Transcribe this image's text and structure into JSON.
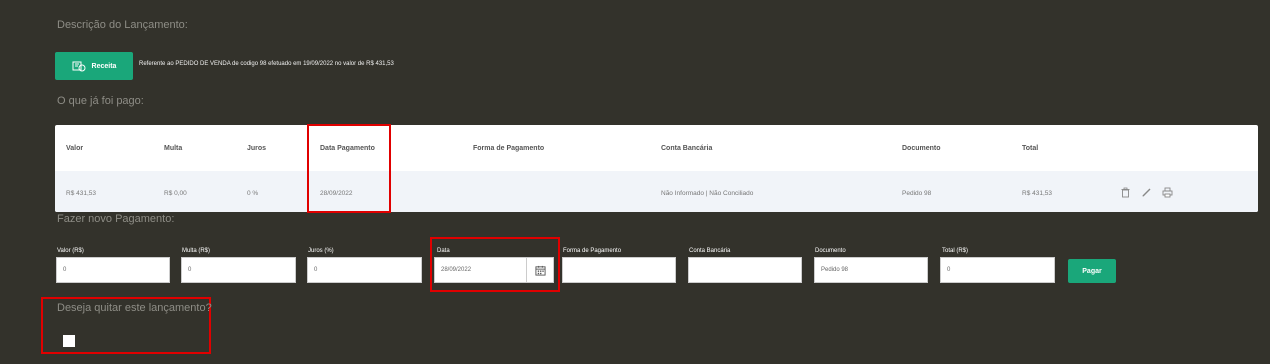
{
  "description_heading": "Descrição do Lançamento:",
  "receita_button": "Receita",
  "reference_text": "Referente ao PEDIDO DE VENDA de codigo 98 efetuado em 19/09/2022 no valor de R$ 431,53",
  "paid_heading": "O que já foi pago:",
  "table": {
    "headers": [
      "Valor",
      "Multa",
      "Juros",
      "Data Pagamento",
      "Forma de Pagamento",
      "Conta Bancária",
      "Documento",
      "Total"
    ],
    "row": {
      "valor": "R$ 431,53",
      "multa": "R$ 0,00",
      "juros": "0 %",
      "data": "28/09/2022",
      "forma": "",
      "conta": "Não Informado | Não Conciliado",
      "documento": "Pedido 98",
      "total": "R$ 431,53"
    },
    "row_action_icons": [
      "trash-icon",
      "pencil-icon",
      "print-icon"
    ]
  },
  "new_payment_heading": "Fazer novo Pagamento:",
  "form": {
    "valor": {
      "label": "Valor (R$)",
      "value": "0"
    },
    "multa": {
      "label": "Multa (R$)",
      "value": "0"
    },
    "juros": {
      "label": "Juros (%)",
      "value": "0"
    },
    "data": {
      "label": "Data",
      "value": "28/09/2022"
    },
    "forma": {
      "label": "Forma de Pagamento",
      "value": ""
    },
    "conta": {
      "label": "Conta Bancária",
      "value": ""
    },
    "documento": {
      "label": "Documento",
      "value": "Pedido 98"
    },
    "total": {
      "label": "Total (R$)",
      "value": "0"
    }
  },
  "pagar_button": "Pagar",
  "quit_question": "Deseja quitar este lançamento?",
  "colors": {
    "background": "#33322b",
    "accent": "#1aa77a",
    "highlight": "#e00000"
  }
}
